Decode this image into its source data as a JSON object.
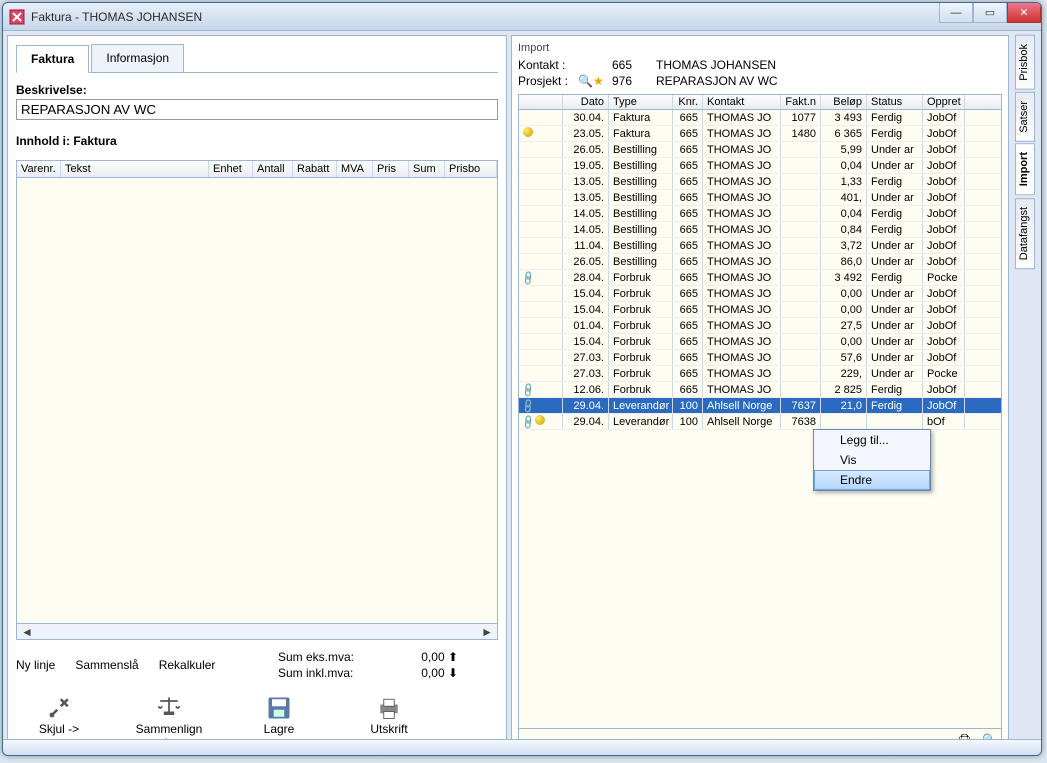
{
  "window": {
    "title": "Faktura - THOMAS JOHANSEN"
  },
  "tabs_left": {
    "faktura": "Faktura",
    "informasjon": "Informasjon"
  },
  "beskrivelse": {
    "label": "Beskrivelse:",
    "value": "REPARASJON AV WC"
  },
  "innhold": {
    "label": "Innhold i: Faktura",
    "cols": {
      "varenr": "Varenr.",
      "tekst": "Tekst",
      "enhet": "Enhet",
      "antall": "Antall",
      "rabatt": "Rabatt",
      "mva": "MVA",
      "pris": "Pris",
      "sum": "Sum",
      "prisbo": "Prisbo"
    }
  },
  "sumrow": {
    "nylinje": "Ny linje",
    "sammensla": "Sammenslå",
    "rekalkuler": "Rekalkuler",
    "sum_eks_label": "Sum eks.mva:",
    "sum_eks": "0,00",
    "sum_inkl_label": "Sum inkl.mva:",
    "sum_inkl": "0,00"
  },
  "toolbar": {
    "skjul": "Skjul ->",
    "sammenlign": "Sammenlign priser",
    "lagre": "Lagre",
    "utskrift": "Utskrift"
  },
  "import": {
    "title": "Import",
    "kontakt_label": "Kontakt :",
    "kontakt_id": "665",
    "kontakt_name": "THOMAS JOHANSEN",
    "prosjekt_label": "Prosjekt :",
    "prosjekt_id": "976",
    "prosjekt_name": "REPARASJON AV WC",
    "cols": {
      "dato": "Dato",
      "type": "Type",
      "knr": "Knr.",
      "kontakt": "Kontakt",
      "fakt": "Fakt.n",
      "belop": "Beløp",
      "status": "Status",
      "oppret": "Oppret"
    },
    "rows": [
      {
        "icon": "",
        "dato": "30.04.",
        "type": "Faktura",
        "knr": "665",
        "kontakt": "THOMAS JO",
        "fakt": "1077",
        "belop": "3 493",
        "status": "Ferdig",
        "oppret": "JobOf"
      },
      {
        "icon": "ball",
        "dato": "23.05.",
        "type": "Faktura",
        "knr": "665",
        "kontakt": "THOMAS JO",
        "fakt": "1480",
        "belop": "6 365",
        "status": "Ferdig",
        "oppret": "JobOf"
      },
      {
        "icon": "",
        "dato": "26.05.",
        "type": "Bestilling",
        "knr": "665",
        "kontakt": "THOMAS JO",
        "fakt": "",
        "belop": "5,99",
        "status": "Under ar",
        "oppret": "JobOf"
      },
      {
        "icon": "",
        "dato": "19.05.",
        "type": "Bestilling",
        "knr": "665",
        "kontakt": "THOMAS JO",
        "fakt": "",
        "belop": "0,04",
        "status": "Under ar",
        "oppret": "JobOf"
      },
      {
        "icon": "",
        "dato": "13.05.",
        "type": "Bestilling",
        "knr": "665",
        "kontakt": "THOMAS JO",
        "fakt": "",
        "belop": "1,33",
        "status": "Ferdig",
        "oppret": "JobOf"
      },
      {
        "icon": "",
        "dato": "13.05.",
        "type": "Bestilling",
        "knr": "665",
        "kontakt": "THOMAS JO",
        "fakt": "",
        "belop": "401,",
        "status": "Under ar",
        "oppret": "JobOf"
      },
      {
        "icon": "",
        "dato": "14.05.",
        "type": "Bestilling",
        "knr": "665",
        "kontakt": "THOMAS JO",
        "fakt": "",
        "belop": "0,04",
        "status": "Ferdig",
        "oppret": "JobOf"
      },
      {
        "icon": "",
        "dato": "14.05.",
        "type": "Bestilling",
        "knr": "665",
        "kontakt": "THOMAS JO",
        "fakt": "",
        "belop": "0,84",
        "status": "Ferdig",
        "oppret": "JobOf"
      },
      {
        "icon": "",
        "dato": "11.04.",
        "type": "Bestilling",
        "knr": "665",
        "kontakt": "THOMAS JO",
        "fakt": "",
        "belop": "3,72",
        "status": "Under ar",
        "oppret": "JobOf"
      },
      {
        "icon": "",
        "dato": "26.05.",
        "type": "Bestilling",
        "knr": "665",
        "kontakt": "THOMAS JO",
        "fakt": "",
        "belop": "86,0",
        "status": "Under ar",
        "oppret": "JobOf"
      },
      {
        "icon": "chain",
        "dato": "28.04.",
        "type": "Forbruk",
        "knr": "665",
        "kontakt": "THOMAS JO",
        "fakt": "",
        "belop": "3 492",
        "status": "Ferdig",
        "oppret": "Pocke"
      },
      {
        "icon": "",
        "dato": "15.04.",
        "type": "Forbruk",
        "knr": "665",
        "kontakt": "THOMAS JO",
        "fakt": "",
        "belop": "0,00",
        "status": "Under ar",
        "oppret": "JobOf"
      },
      {
        "icon": "",
        "dato": "15.04.",
        "type": "Forbruk",
        "knr": "665",
        "kontakt": "THOMAS JO",
        "fakt": "",
        "belop": "0,00",
        "status": "Under ar",
        "oppret": "JobOf"
      },
      {
        "icon": "",
        "dato": "01.04.",
        "type": "Forbruk",
        "knr": "665",
        "kontakt": "THOMAS JO",
        "fakt": "",
        "belop": "27,5",
        "status": "Under ar",
        "oppret": "JobOf"
      },
      {
        "icon": "",
        "dato": "15.04.",
        "type": "Forbruk",
        "knr": "665",
        "kontakt": "THOMAS JO",
        "fakt": "",
        "belop": "0,00",
        "status": "Under ar",
        "oppret": "JobOf"
      },
      {
        "icon": "",
        "dato": "27.03.",
        "type": "Forbruk",
        "knr": "665",
        "kontakt": "THOMAS JO",
        "fakt": "",
        "belop": "57,6",
        "status": "Under ar",
        "oppret": "JobOf"
      },
      {
        "icon": "",
        "dato": "27.03.",
        "type": "Forbruk",
        "knr": "665",
        "kontakt": "THOMAS JO",
        "fakt": "",
        "belop": "229,",
        "status": "Under ar",
        "oppret": "Pocke"
      },
      {
        "icon": "chain",
        "dato": "12.06.",
        "type": "Forbruk",
        "knr": "665",
        "kontakt": "THOMAS JO",
        "fakt": "",
        "belop": "2 825",
        "status": "Ferdig",
        "oppret": "JobOf"
      },
      {
        "icon": "chain",
        "dato": "29.04.",
        "type": "Leverandør",
        "knr": "100",
        "kontakt": "Ahlsell Norge",
        "fakt": "7637",
        "belop": "21,0",
        "status": "Ferdig",
        "oppret": "JobOf",
        "selected": true
      },
      {
        "icon": "chainball",
        "dato": "29.04.",
        "type": "Leverandør",
        "knr": "100",
        "kontakt": "Ahlsell Norge",
        "fakt": "7638",
        "belop": "",
        "status": "",
        "oppret": "bOf"
      }
    ]
  },
  "context_menu": {
    "leggtil": "Legg til...",
    "vis": "Vis",
    "endre": "Endre"
  },
  "side_tabs": {
    "prisbok": "Prisbok",
    "satser": "Satser",
    "import": "Import",
    "datafangst": "Datafangst"
  }
}
